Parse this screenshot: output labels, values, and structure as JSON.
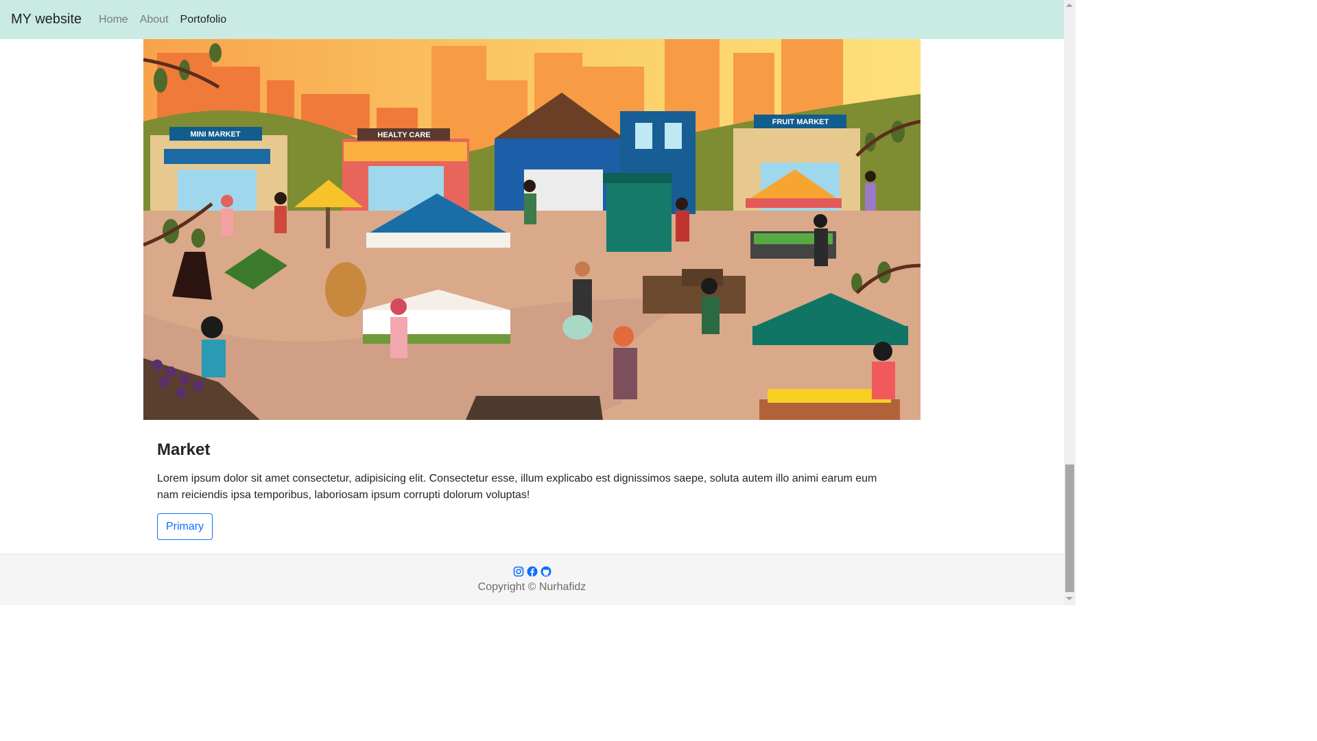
{
  "navbar": {
    "brand": "MY website",
    "links": [
      {
        "label": "Home"
      },
      {
        "label": "About"
      },
      {
        "label": "Portofolio"
      }
    ]
  },
  "hero": {
    "signs": [
      "MINI MARKET",
      "HEALTY CARE",
      "FRUIT MARKET"
    ]
  },
  "card": {
    "title": "Market",
    "text": "Lorem ipsum dolor sit amet consectetur, adipisicing elit. Consectetur esse, illum explicabo est dignissimos saepe, soluta autem illo animi earum eum nam reiciendis ipsa temporibus, laboriosam ipsum corrupti dolorum voluptas!",
    "button_label": "Primary"
  },
  "footer": {
    "icons": [
      "instagram-icon",
      "facebook-icon",
      "github-icon"
    ],
    "copyright": "Copyright © Nurhafidz"
  },
  "colors": {
    "navbar_bg": "#c9ebe4",
    "accent": "#0d6efd"
  }
}
